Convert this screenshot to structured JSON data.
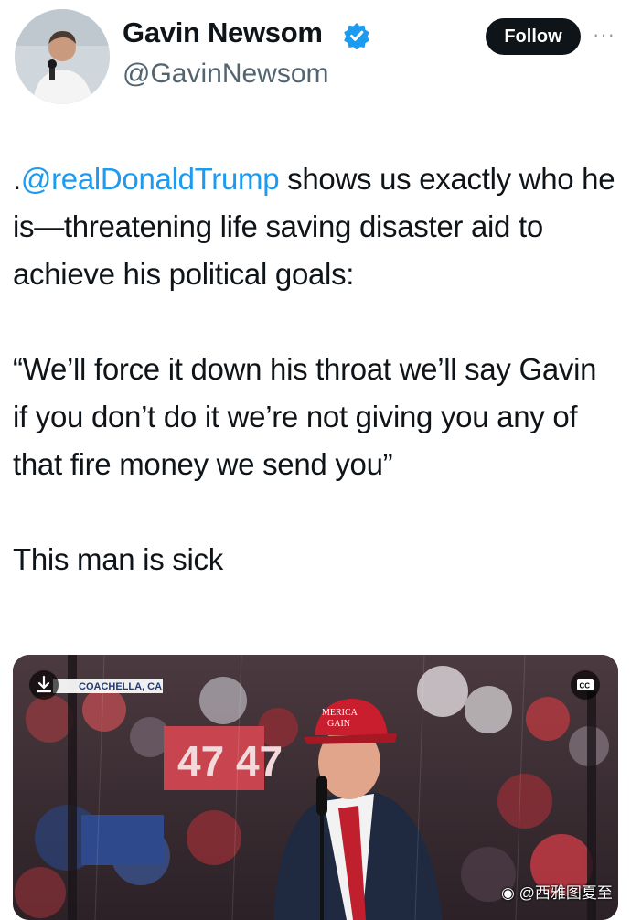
{
  "author": {
    "display_name": "Gavin Newsom",
    "handle": "@GavinNewsom",
    "verified_icon": "verified-badge-icon"
  },
  "actions": {
    "follow_label": "Follow",
    "more_label": "···"
  },
  "tweet": {
    "mention": "@realDonaldTrump",
    "p1_prefix": ".",
    "p1_rest": " shows us exactly who he is—threatening life saving disaster aid to achieve his political goals:",
    "p2": "“We’ll force it down his throat we’ll say Gavin if you don’t do it we’re not giving you any of that fire money we send you”",
    "p3": "This man is sick"
  },
  "media": {
    "location_label": "COACHELLA, CA",
    "download_icon": "download-icon",
    "captions_icon": "closed-captions-icon",
    "captions_label": "CC",
    "sign_text": "47 47",
    "hat_text": "MERICA GAIN"
  },
  "watermark": {
    "text": "@西雅图夏至",
    "icon": "weibo-icon"
  }
}
